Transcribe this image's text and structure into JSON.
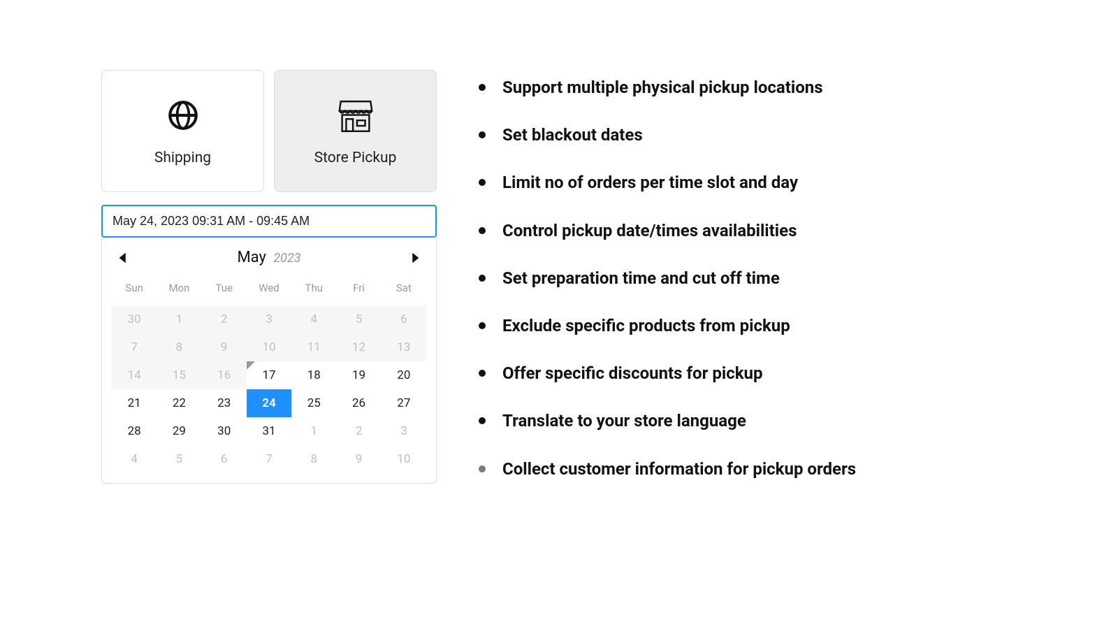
{
  "delivery": {
    "shipping_label": "Shipping",
    "pickup_label": "Store Pickup"
  },
  "date_input": {
    "value": "May 24, 2023 09:31 AM - 09:45 AM"
  },
  "calendar": {
    "month": "May",
    "year": "2023",
    "dow": [
      "Sun",
      "Mon",
      "Tue",
      "Wed",
      "Thu",
      "Fri",
      "Sat"
    ],
    "selected": "24",
    "rows": [
      [
        {
          "d": "30",
          "m": true
        },
        {
          "d": "1",
          "m": true
        },
        {
          "d": "2",
          "m": true
        },
        {
          "d": "3",
          "m": true
        },
        {
          "d": "4",
          "m": true
        },
        {
          "d": "5",
          "m": true
        },
        {
          "d": "6",
          "m": true
        }
      ],
      [
        {
          "d": "7",
          "m": true
        },
        {
          "d": "8",
          "m": true
        },
        {
          "d": "9",
          "m": true
        },
        {
          "d": "10",
          "m": true
        },
        {
          "d": "11",
          "m": true
        },
        {
          "d": "12",
          "m": true
        },
        {
          "d": "13",
          "m": true
        }
      ],
      [
        {
          "d": "14",
          "m": true
        },
        {
          "d": "15",
          "m": true
        },
        {
          "d": "16",
          "m": true
        },
        {
          "d": "17",
          "tc": true
        },
        {
          "d": "18"
        },
        {
          "d": "19"
        },
        {
          "d": "20"
        }
      ],
      [
        {
          "d": "21"
        },
        {
          "d": "22"
        },
        {
          "d": "23"
        },
        {
          "d": "24",
          "sel": true
        },
        {
          "d": "25"
        },
        {
          "d": "26"
        },
        {
          "d": "27"
        }
      ],
      [
        {
          "d": "28"
        },
        {
          "d": "29"
        },
        {
          "d": "30"
        },
        {
          "d": "31"
        },
        {
          "d": "1",
          "m2": true
        },
        {
          "d": "2",
          "m2": true
        },
        {
          "d": "3",
          "m2": true
        }
      ],
      [
        {
          "d": "4",
          "m2": true
        },
        {
          "d": "5",
          "m2": true
        },
        {
          "d": "6",
          "m2": true
        },
        {
          "d": "7",
          "m2": true
        },
        {
          "d": "8",
          "m2": true
        },
        {
          "d": "9",
          "m2": true
        },
        {
          "d": "10",
          "m2": true
        }
      ]
    ]
  },
  "features": [
    "Support multiple physical pickup locations",
    "Set blackout dates",
    "Limit no of orders per time slot and day",
    "Control pickup date/times availabilities",
    "Set preparation time and cut off time",
    "Exclude specific products from pickup",
    "Offer specific discounts for pickup",
    "Translate to your store language",
    "Collect customer information for pickup orders"
  ]
}
